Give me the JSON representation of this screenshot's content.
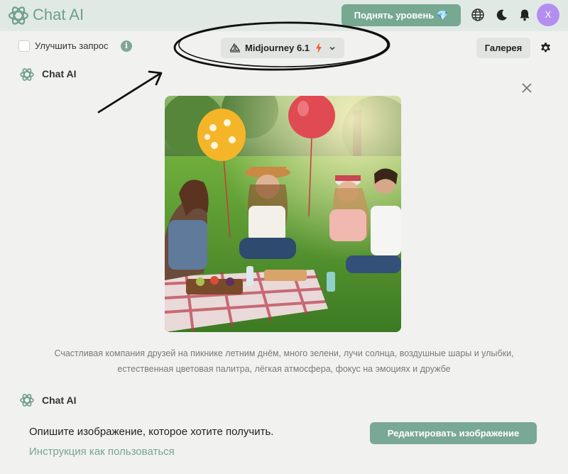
{
  "header": {
    "app_name": "Chat AI",
    "upgrade_label": "Поднять уровень",
    "upgrade_icon": "💎",
    "avatar_initial": "X"
  },
  "toolbar": {
    "improve_label": "Улучшить запрос",
    "improve_checked": false,
    "info_icon_glyph": "i",
    "model_label": "Midjourney 6.1",
    "gallery_label": "Галерея"
  },
  "chat": {
    "messages": [
      {
        "sender": "Chat AI",
        "image_caption": "Счастливая компания друзей на пикнике летним днём, много зелени, лучи солнца, воздушные шары и улыбки, естественная цветовая палитра, лёгкая атмосфера, фокус на эмоциях и дружбе"
      },
      {
        "sender": "Chat AI",
        "text": "Опишите изображение, которое хотите получить.",
        "link": "Инструкция как пользоваться",
        "edit_button": "Редактировать изображение"
      }
    ]
  },
  "colors": {
    "accent": "#76a892",
    "topbar_bg": "#e1e9e5",
    "avatar": "#b38ef0"
  }
}
